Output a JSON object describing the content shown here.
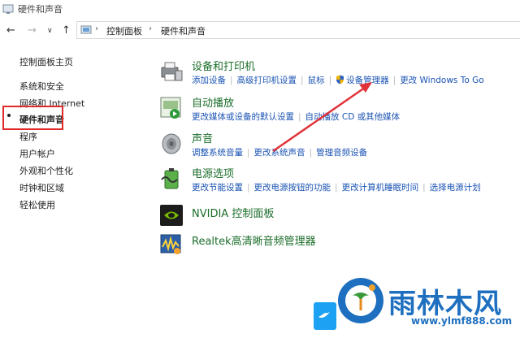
{
  "window": {
    "title": "硬件和声音"
  },
  "nav": {
    "back_icon": "back-arrow-icon",
    "forward_icon": "forward-arrow-icon",
    "recent_icon": "chevron-down-icon",
    "up_icon": "up-arrow-icon"
  },
  "breadcrumb": {
    "items": [
      "控制面板",
      "硬件和声音"
    ],
    "separator": "›"
  },
  "sidebar": {
    "items": [
      {
        "label": "控制面板主页"
      },
      {
        "label": "系统和安全"
      },
      {
        "label": "网络和 Internet"
      },
      {
        "label": "硬件和声音"
      },
      {
        "label": "程序"
      },
      {
        "label": "用户帐户"
      },
      {
        "label": "外观和个性化"
      },
      {
        "label": "时钟和区域"
      },
      {
        "label": "轻松使用"
      }
    ]
  },
  "categories": [
    {
      "title": "设备和打印机",
      "icon": "printer-icon",
      "links": [
        "添加设备",
        "高级打印机设置",
        "鼠标",
        "设备管理器",
        "更改 Windows To Go"
      ]
    },
    {
      "title": "自动播放",
      "icon": "autoplay-icon",
      "links": [
        "更改媒体或设备的默认设置",
        "自动播放 CD 或其他媒体"
      ]
    },
    {
      "title": "声音",
      "icon": "speaker-icon",
      "links": [
        "调整系统音量",
        "更改系统声音",
        "管理音频设备"
      ]
    },
    {
      "title": "电源选项",
      "icon": "power-battery-icon",
      "links": [
        "更改节能设置",
        "更改电源按钮的功能",
        "更改计算机睡眠时间",
        "选择电源计划"
      ]
    },
    {
      "title": "NVIDIA 控制面板",
      "icon": "nvidia-icon",
      "links": []
    },
    {
      "title": "Realtek高清晰音频管理器",
      "icon": "realtek-audio-icon",
      "links": []
    }
  ],
  "watermark": {
    "brand": "雨林木风",
    "url": "www.ylmf888.com"
  },
  "colors": {
    "link": "#1a53b3",
    "category_title": "#1b6e2a",
    "highlight": "#e02a2a",
    "brand": "#1e6fbf"
  }
}
